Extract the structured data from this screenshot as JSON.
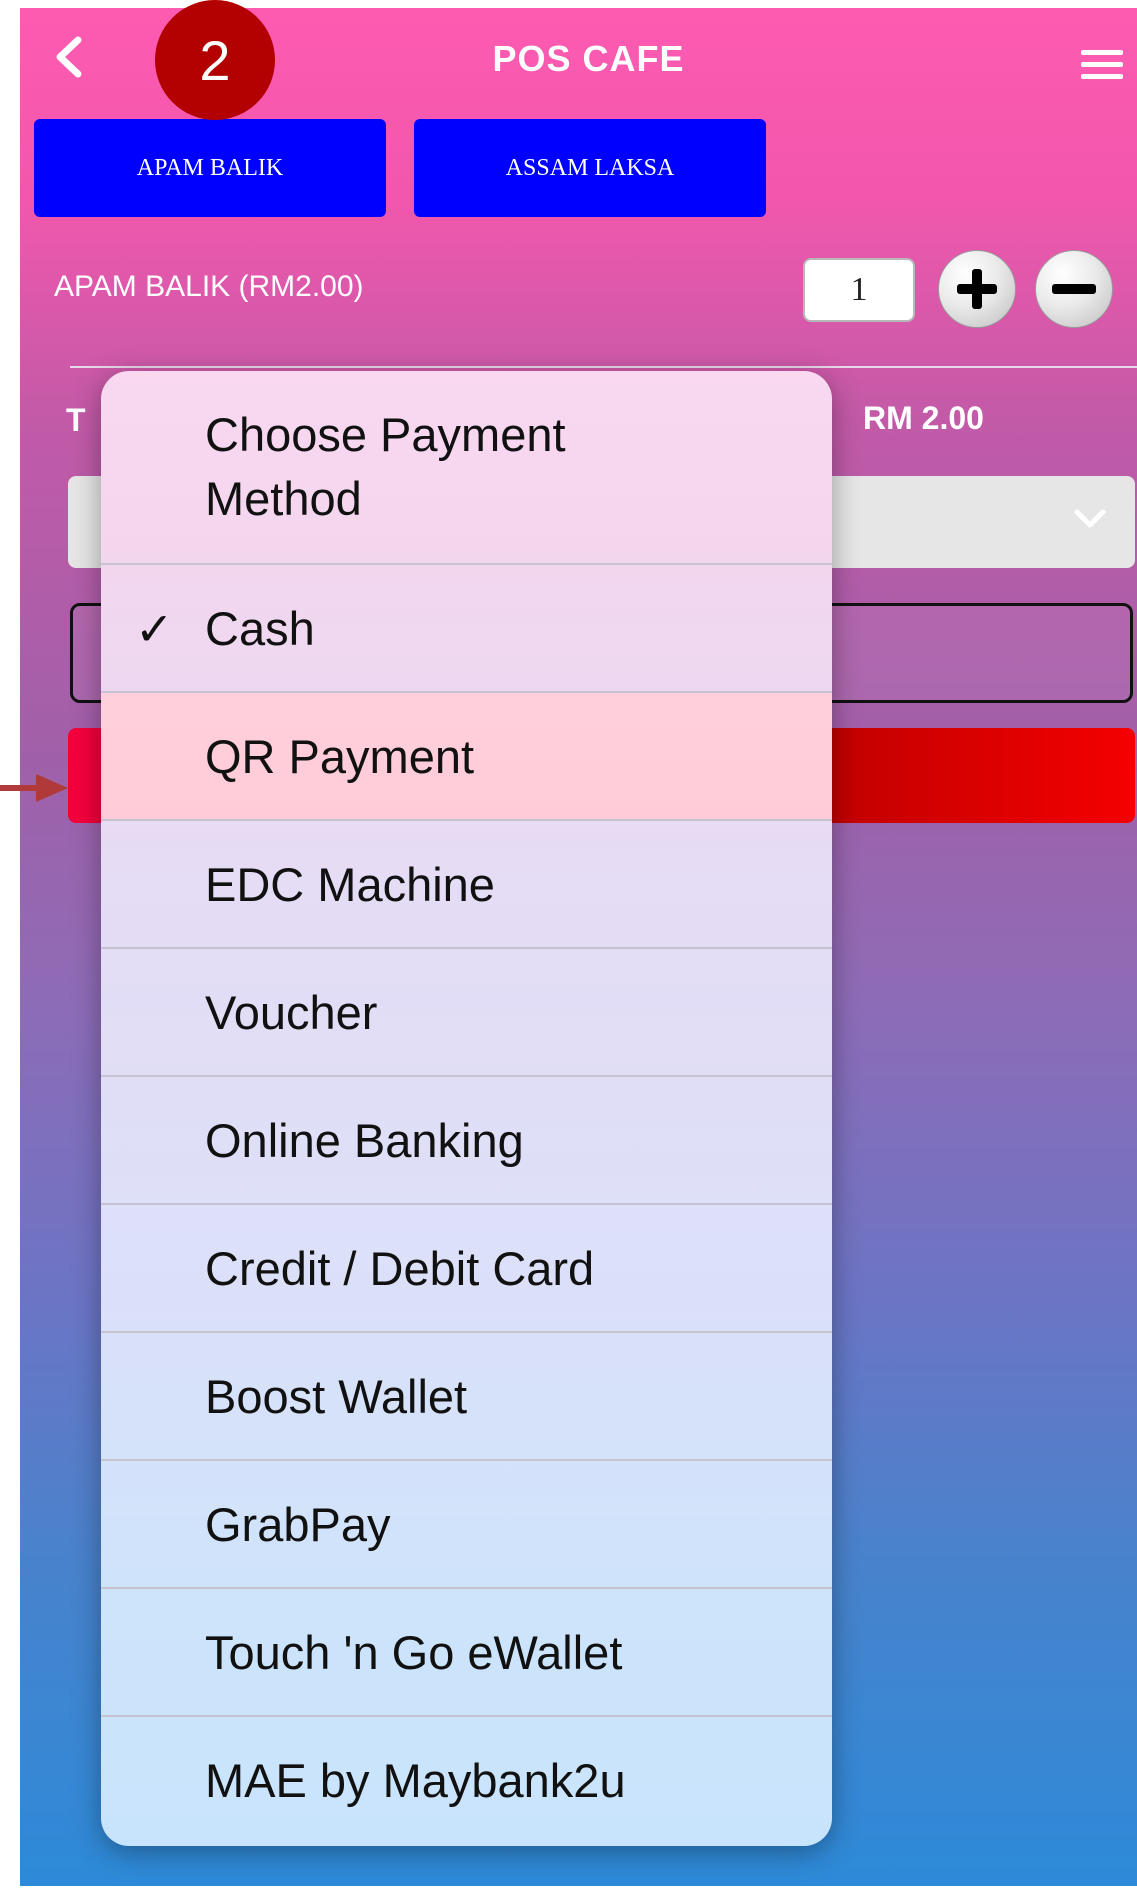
{
  "header": {
    "title": "POS CAFE",
    "step_badge": "2"
  },
  "tabs": [
    "APAM BALIK",
    "ASSAM LAKSA"
  ],
  "order": {
    "item_label": "APAM BALIK (RM2.00)",
    "quantity": "1",
    "total_prefix": "T",
    "total_amount": "RM 2.00"
  },
  "payment_picker": {
    "header": "Choose Payment Method",
    "header_line1": "Choose Payment",
    "header_line2": "Method",
    "selected": "Cash",
    "highlighted": "QR Payment",
    "options": [
      "Cash",
      "QR Payment",
      "EDC Machine",
      "Voucher",
      "Online Banking",
      "Credit / Debit Card",
      "Boost Wallet",
      "GrabPay",
      "Touch 'n Go eWallet",
      "MAE by Maybank2u"
    ]
  },
  "colors": {
    "badge": "#b30000",
    "tab": "#0000ff",
    "pay_button": "#f00000",
    "annotation_arrow": "#b03a3a"
  }
}
